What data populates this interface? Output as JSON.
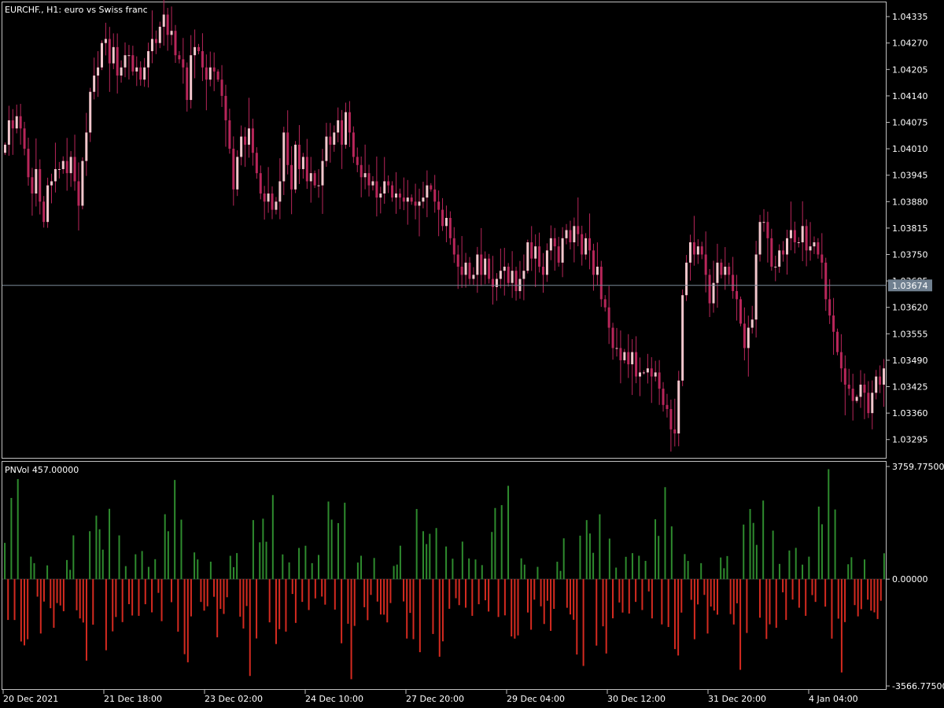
{
  "chart_title": "EURCHF., H1:  euro vs Swiss franc",
  "indicator_label": "PNVol 457.00000",
  "current_price_label": "1.03674",
  "colors": {
    "background": "#000000",
    "frame": "#c0c0c0",
    "candle": "#b8265a",
    "candle_up_body": "#f2c6cc",
    "volume_positive": "#2e8b2e",
    "volume_negative": "#d42a20",
    "price_line": "#7c8a99",
    "price_tag_bg": "#708090"
  },
  "chart_data": [
    {
      "type": "candlestick",
      "title": "EURCHF., H1:  euro vs Swiss franc",
      "y_ticks": [
        "1.04335",
        "1.04270",
        "1.04205",
        "1.04140",
        "1.04075",
        "1.04010",
        "1.03945",
        "1.03880",
        "1.03815",
        "1.03750",
        "1.03685",
        "1.03620",
        "1.03555",
        "1.03490",
        "1.03425",
        "1.03360",
        "1.03295"
      ],
      "ylim": [
        1.0325,
        1.0437
      ],
      "current_price": 1.03674,
      "series": [
        {
          "values": [
            1.0402,
            1.0408,
            1.0406,
            1.0409,
            1.0406,
            1.0401,
            1.0394,
            1.039,
            1.0396,
            1.0388,
            1.0383,
            1.0392,
            1.0393,
            1.0396,
            1.0396,
            1.0398,
            1.0395,
            1.0399,
            1.0393,
            1.0387,
            1.0398,
            1.0405,
            1.0415,
            1.0419,
            1.0421,
            1.0427,
            1.0428,
            1.0422,
            1.0426,
            1.0419,
            1.0421,
            1.0424,
            1.0424,
            1.042,
            1.0421,
            1.0418,
            1.0421,
            1.0425,
            1.0428,
            1.0427,
            1.0431,
            1.0434,
            1.0429,
            1.043,
            1.0424,
            1.0423,
            1.0421,
            1.0413,
            1.0424,
            1.0426,
            1.0425,
            1.0421,
            1.0418,
            1.0421,
            1.042,
            1.0418,
            1.0414,
            1.0408,
            1.0401,
            1.0391,
            1.0399,
            1.0404,
            1.0402,
            1.0406,
            1.04,
            1.0395,
            1.039,
            1.0388,
            1.039,
            1.0386,
            1.0388,
            1.0393,
            1.0405,
            1.0397,
            1.0391,
            1.0402,
            1.0396,
            1.0399,
            1.0393,
            1.0395,
            1.0392,
            1.0392,
            1.0398,
            1.0404,
            1.0402,
            1.0405,
            1.0408,
            1.0402,
            1.041,
            1.0405,
            1.0399,
            1.0397,
            1.0394,
            1.0395,
            1.0392,
            1.0393,
            1.0389,
            1.039,
            1.0393,
            1.0392,
            1.0389,
            1.039,
            1.0389,
            1.0388,
            1.0389,
            1.0388,
            1.0387,
            1.0388,
            1.0389,
            1.0392,
            1.0391,
            1.0388,
            1.0386,
            1.0382,
            1.0384,
            1.0379,
            1.0375,
            1.0372,
            1.037,
            1.0373,
            1.0369,
            1.037,
            1.0375,
            1.037,
            1.0374,
            1.0369,
            1.0367,
            1.0369,
            1.0371,
            1.0372,
            1.0368,
            1.0371,
            1.0366,
            1.0369,
            1.0371,
            1.0378,
            1.0374,
            1.0377,
            1.0372,
            1.037,
            1.0376,
            1.0379,
            1.0377,
            1.0373,
            1.0379,
            1.0381,
            1.0378,
            1.0382,
            1.038,
            1.0375,
            1.0379,
            1.0376,
            1.037,
            1.0372,
            1.0364,
            1.0362,
            1.0357,
            1.0352,
            1.0352,
            1.0349,
            1.0351,
            1.0348,
            1.0351,
            1.0345,
            1.0346,
            1.0346,
            1.0347,
            1.0345,
            1.0346,
            1.0342,
            1.0338,
            1.0337,
            1.0332,
            1.0331,
            1.0344,
            1.0365,
            1.0373,
            1.0378,
            1.0375,
            1.0377,
            1.0375,
            1.037,
            1.0363,
            1.0368,
            1.0373,
            1.037,
            1.0372,
            1.037,
            1.0366,
            1.0364,
            1.0358,
            1.0352,
            1.0357,
            1.0359,
            1.0375,
            1.0383,
            1.0383,
            1.0379,
            1.0372,
            1.0372,
            1.0376,
            1.0375,
            1.0379,
            1.0381,
            1.0378,
            1.0378,
            1.0382,
            1.0376,
            1.0377,
            1.0378,
            1.0375,
            1.0373,
            1.0364,
            1.036,
            1.0356,
            1.0351,
            1.0347,
            1.0343,
            1.0342,
            1.0339,
            1.034,
            1.0343,
            1.0341,
            1.0336,
            1.0341,
            1.0345,
            1.0343,
            1.0347
          ]
        }
      ]
    },
    {
      "type": "bar",
      "title": "PNVol 457.00000",
      "y_ticks": [
        "3759.77500",
        "0.00000",
        "-3566.77500"
      ],
      "ylim": [
        -3566.775,
        3759.775
      ],
      "x_ticks": [
        "20 Dec 2021",
        "21 Dec 18:00",
        "23 Dec 02:00",
        "24 Dec 10:00",
        "27 Dec 20:00",
        "29 Dec 04:00",
        "30 Dec 12:00",
        "31 Dec 20:00",
        "4 Jan 04:00"
      ],
      "series": [
        {
          "values": [
            2200,
            -1400,
            3400,
            -2200,
            3200,
            -2400,
            -3200,
            -1800,
            800,
            700,
            -1000,
            -1800,
            -900,
            700,
            -900,
            -1800,
            -1100,
            -1600,
            -1100,
            800,
            500,
            1400,
            -1200,
            -1900,
            -1300,
            -2900,
            2100,
            -2600,
            2100,
            2000,
            1500,
            -2200,
            2600,
            -2400,
            -2300,
            1500,
            -1800,
            700,
            -800,
            -1400,
            1200,
            -1100,
            1000,
            -1100,
            700,
            -1100,
            800,
            -700,
            -1300,
            2400
          ]
        }
      ]
    }
  ]
}
